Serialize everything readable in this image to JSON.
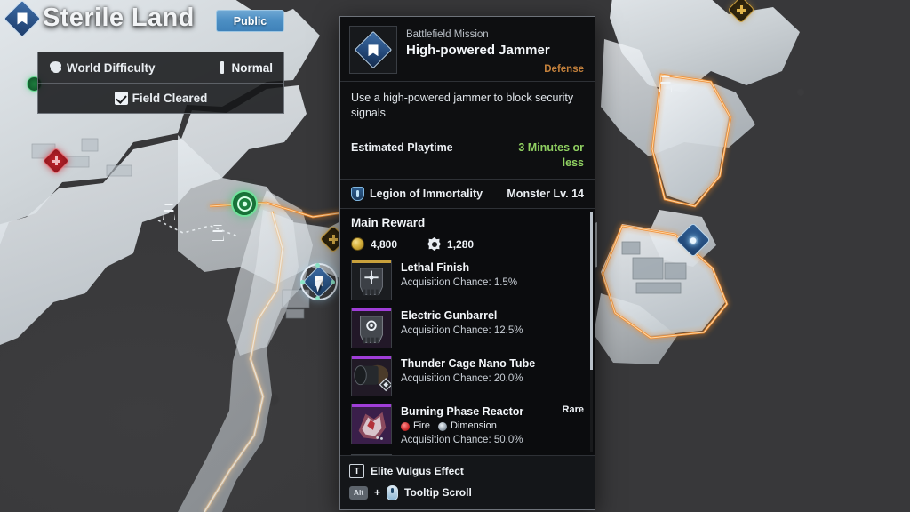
{
  "map": {
    "title": "Sterile Land",
    "title_icon": "mission-diamond-icon",
    "public_button": "Public",
    "filters": {
      "difficulty_icon": "skull-icon",
      "difficulty_label": "World Difficulty",
      "difficulty_value": "Normal",
      "cleared_icon": "checkbox-checked-icon",
      "cleared_label": "Field Cleared"
    },
    "markers": [
      {
        "name": "map-marker-red-diamond",
        "icon": "red-diamond-marker"
      },
      {
        "name": "map-marker-green-target",
        "icon": "green-target-marker"
      },
      {
        "name": "map-marker-gold-diamond",
        "icon": "gold-diamond-marker"
      },
      {
        "name": "map-marker-blue-selected",
        "icon": "blue-mission-marker"
      },
      {
        "name": "map-marker-blue-objective",
        "icon": "blue-objective-marker"
      }
    ]
  },
  "tooltip": {
    "icon": "mission-diamond-icon",
    "kind": "Battlefield Mission",
    "name": "High-powered Jammer",
    "tag": "Defense",
    "tag_color": "#c4813c",
    "description": "Use a high-powered jammer to block security signals",
    "playtime_label": "Estimated Playtime",
    "playtime_value": "3 Minutes or less",
    "playtime_color": "#8fcf61",
    "faction_icon": "faction-shield-icon",
    "faction_name": "Legion of Immortality",
    "monster_level": "Monster Lv. 14",
    "reward_title": "Main Reward",
    "currencies": [
      {
        "icon": "gold-coin-icon",
        "amount": "4,800"
      },
      {
        "icon": "xp-token-icon",
        "amount": "1,280"
      }
    ],
    "items": [
      {
        "name": "Lethal Finish",
        "chance": "Acquisition Chance: 1.5%",
        "rarity_color": "#c9a13c",
        "rarity_label": "",
        "icon": "module-card-icon",
        "elements": []
      },
      {
        "name": "Electric Gunbarrel",
        "chance": "Acquisition Chance: 12.5%",
        "rarity_color": "#a03ed8",
        "rarity_label": "",
        "icon": "module-card-icon",
        "elements": []
      },
      {
        "name": "Thunder Cage Nano Tube",
        "chance": "Acquisition Chance: 20.0%",
        "rarity_color": "#a03ed8",
        "rarity_label": "",
        "icon": "nano-tube-icon",
        "elements": []
      },
      {
        "name": "Burning Phase Reactor",
        "chance": "Acquisition Chance: 50.0%",
        "rarity_color": "#a03ed8",
        "rarity_label": "Rare",
        "icon": "reactor-icon",
        "elements": [
          {
            "label": "Fire",
            "icon": "fire-element-icon",
            "color": "#cf2b2b"
          },
          {
            "label": "Dimension",
            "icon": "dimension-element-icon",
            "color": "#9aa6b2"
          }
        ]
      },
      {
        "name": "",
        "chance": "",
        "rarity_color": "#2fb6d8",
        "rarity_label": "",
        "icon": "descendant-icon",
        "elements": []
      }
    ],
    "footer": [
      {
        "key": "T",
        "key_style": "outline",
        "label": "Elite Vulgus Effect",
        "icon": ""
      },
      {
        "key": "Alt",
        "key_style": "filled",
        "label": "Tooltip Scroll",
        "icon": "mouse-scroll-icon"
      }
    ]
  }
}
